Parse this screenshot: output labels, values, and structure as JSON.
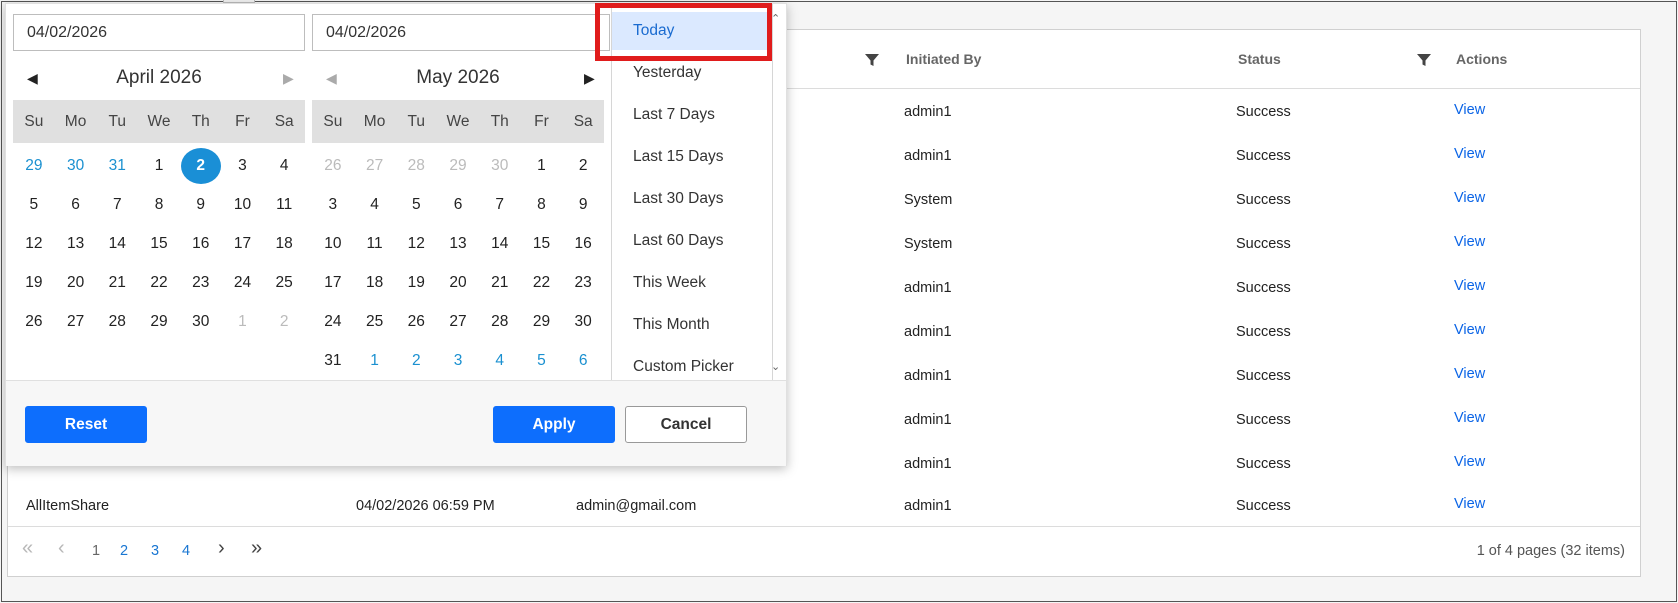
{
  "grid": {
    "headers": {
      "initiated_by": "Initiated By",
      "status": "Status",
      "actions": "Actions"
    },
    "rows": [
      {
        "initiated_by": "admin1",
        "status": "Success",
        "action": "View"
      },
      {
        "initiated_by": "admin1",
        "status": "Success",
        "action": "View"
      },
      {
        "initiated_by": "System",
        "status": "Success",
        "action": "View"
      },
      {
        "initiated_by": "System",
        "status": "Success",
        "action": "View"
      },
      {
        "initiated_by": "admin1",
        "status": "Success",
        "action": "View"
      },
      {
        "initiated_by": "admin1",
        "status": "Success",
        "action": "View"
      },
      {
        "initiated_by": "admin1",
        "status": "Success",
        "action": "View"
      },
      {
        "initiated_by": "admin1",
        "status": "Success",
        "action": "View"
      },
      {
        "initiated_by": "admin1",
        "status": "Success",
        "action": "View"
      },
      {
        "name": "AllItemShare",
        "date": "04/02/2026 06:59 PM",
        "email": "admin@gmail.com",
        "initiated_by": "admin1",
        "status": "Success",
        "action": "View"
      }
    ],
    "pager": {
      "first": "«",
      "prev": "‹",
      "next": "›",
      "last": "»",
      "pages": [
        "1",
        "2",
        "3",
        "4"
      ],
      "current_page": "1",
      "summary": "1 of 4 pages (32 items)"
    }
  },
  "daterange": {
    "start_value": "04/02/2026",
    "end_value": "04/02/2026",
    "left_calendar": {
      "title": "April 2026",
      "dow": [
        "Su",
        "Mo",
        "Tu",
        "We",
        "Th",
        "Fr",
        "Sa"
      ],
      "weeks": [
        [
          "29",
          "30",
          "31",
          "1",
          "2",
          "3",
          "4"
        ],
        [
          "5",
          "6",
          "7",
          "8",
          "9",
          "10",
          "11"
        ],
        [
          "12",
          "13",
          "14",
          "15",
          "16",
          "17",
          "18"
        ],
        [
          "19",
          "20",
          "21",
          "22",
          "23",
          "24",
          "25"
        ],
        [
          "26",
          "27",
          "28",
          "29",
          "30",
          "1",
          "2"
        ]
      ],
      "selected_day": "2"
    },
    "right_calendar": {
      "title": "May 2026",
      "dow": [
        "Su",
        "Mo",
        "Tu",
        "We",
        "Th",
        "Fr",
        "Sa"
      ],
      "weeks": [
        [
          "26",
          "27",
          "28",
          "29",
          "30",
          "1",
          "2"
        ],
        [
          "3",
          "4",
          "5",
          "6",
          "7",
          "8",
          "9"
        ],
        [
          "10",
          "11",
          "12",
          "13",
          "14",
          "15",
          "16"
        ],
        [
          "17",
          "18",
          "19",
          "20",
          "21",
          "22",
          "23"
        ],
        [
          "24",
          "25",
          "26",
          "27",
          "28",
          "29",
          "30"
        ],
        [
          "31",
          "1",
          "2",
          "3",
          "4",
          "5",
          "6"
        ]
      ]
    },
    "presets": [
      "Today",
      "Yesterday",
      "Last 7 Days",
      "Last 15 Days",
      "Last 30 Days",
      "Last 60 Days",
      "This Week",
      "This Month",
      "Custom Picker"
    ],
    "active_preset": "Today",
    "buttons": {
      "reset": "Reset",
      "apply": "Apply",
      "cancel": "Cancel"
    }
  },
  "colors": {
    "accent": "#0d6efd",
    "selected_day": "#1a8fd6",
    "link": "#0a64e6",
    "highlight_box": "#e01c1c",
    "active_preset_bg": "#dbe9ff"
  }
}
